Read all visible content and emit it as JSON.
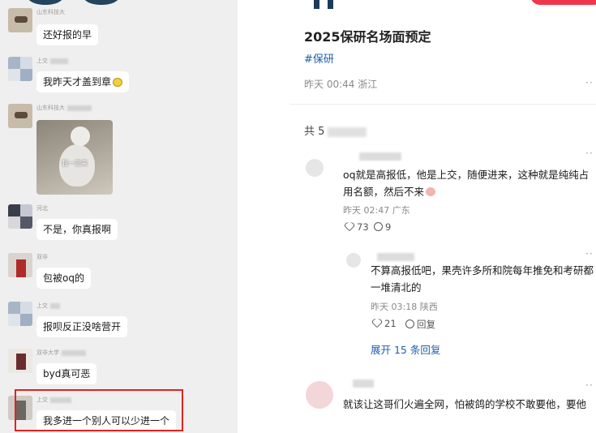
{
  "chat": {
    "messages": [
      {
        "sender": "山东科技大",
        "text": "还好报的早",
        "emoji": false
      },
      {
        "sender": "上交",
        "text": "我昨天才盖到章",
        "emoji": true
      },
      {
        "sender": "山东科技大",
        "sticker_text": "我一定来"
      },
      {
        "sender": "河北",
        "text": "不是，你真报啊",
        "emoji": false
      },
      {
        "sender": "双非",
        "text": "包被oq的",
        "emoji": false
      },
      {
        "sender": "上交",
        "text": "报呗反正没啥营开",
        "emoji": false
      },
      {
        "sender": "双非大学",
        "text": "byd真可恶",
        "emoji": false
      },
      {
        "sender": "上交",
        "text": "我多进一个别人可以少进一个",
        "emoji": false
      }
    ]
  },
  "post": {
    "title": "2025保研名场面预定",
    "tag": "#保研",
    "meta": "昨天 00:44 浙江",
    "count_prefix": "共 5",
    "comments": [
      {
        "text": "oq就是高报低，他是上交，随便进来，这种就是纯纯占用名额，然后不来",
        "meta": "昨天 02:47 广东",
        "likes": "73",
        "replies": "9"
      }
    ],
    "replies": [
      {
        "text": "不算高报低吧，果壳许多所和院每年推免和考研都一堆清北的",
        "meta": "昨天 03:18 陕西",
        "likes": "21",
        "reply_label": "回复"
      }
    ],
    "expand_label": "展开 15 条回复",
    "last_comment": "就该让这哥们火遍全网，怕被鸽的学校不敢要他，要他",
    "colors": {
      "accent": "#1f5fa8",
      "highlight": "#e0231f",
      "brand": "#f0364a"
    }
  }
}
